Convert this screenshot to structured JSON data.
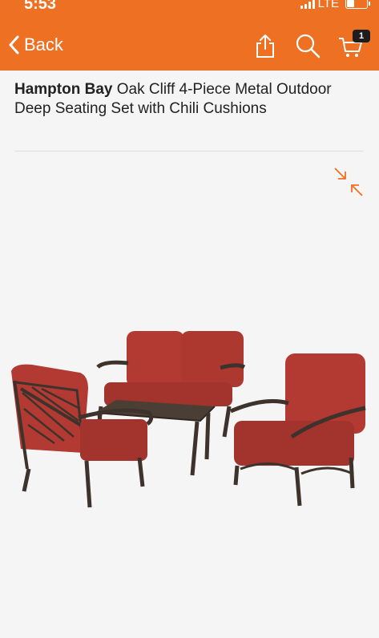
{
  "status_bar": {
    "time": "5:53",
    "network": "LTE"
  },
  "nav": {
    "back_label": "Back",
    "cart_count": "1"
  },
  "product": {
    "brand": "Hampton Bay",
    "name": "Oak Cliff 4-Piece Metal Outdoor Deep Seating Set with Chili Cushions"
  },
  "colors": {
    "brand_orange": "#ee7023",
    "cushion_red": "#b33a32",
    "frame_bronze": "#3e332c"
  },
  "icons": [
    "chevron-left-icon",
    "share-icon",
    "search-icon",
    "cart-icon",
    "collapse-icon"
  ]
}
